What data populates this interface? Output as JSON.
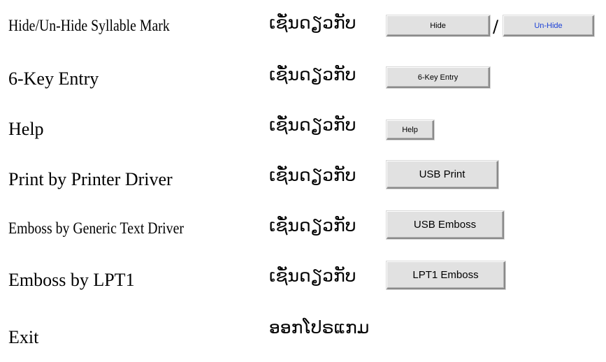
{
  "rows": [
    {
      "term": "Hide/Un-Hide Syllable Mark",
      "lao": "ເຊັ່ນດຽວກັບ",
      "buttons": {
        "hide": "Hide",
        "separator": "/",
        "unhide": "Un-Hide"
      }
    },
    {
      "term": "6-Key Entry",
      "lao": "ເຊັ່ນດຽວກັບ",
      "button": "6-Key Entry"
    },
    {
      "term": "Help",
      "lao": "ເຊັ່ນດຽວກັບ",
      "button": "Help"
    },
    {
      "term": "Print by Printer Driver",
      "lao": "ເຊັ່ນດຽວກັບ",
      "button": "USB Print"
    },
    {
      "term": "Emboss by Generic Text Driver",
      "lao": "ເຊັ່ນດຽວກັບ",
      "button": "USB Emboss"
    },
    {
      "term": "Emboss by LPT1",
      "lao": "ເຊັ່ນດຽວກັບ",
      "button": "LPT1 Emboss"
    },
    {
      "term": "Exit",
      "lao": "ອອກໂປຣແກມ"
    }
  ],
  "colors": {
    "unhide_text": "#1a3fd6",
    "button_face": "#e1e1e1"
  }
}
